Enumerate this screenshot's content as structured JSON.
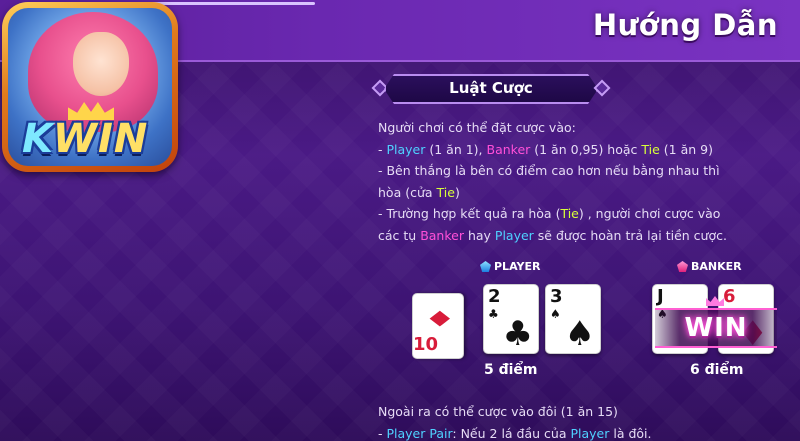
{
  "header": {
    "title": "Hướng Dẫn"
  },
  "logo": {
    "text_k": "K",
    "text_rest": "WIN"
  },
  "section": {
    "title": "Luật Cược"
  },
  "rules": {
    "intro": "Người chơi có thể đặt cược vào:",
    "line1": {
      "prefix": "- ",
      "player": "Player",
      "player_odds": " (1 ăn 1), ",
      "banker": "Banker",
      "banker_odds": " (1 ăn 0,95) hoặc ",
      "tie": "Tie",
      "tie_odds": " (1 ăn 9)"
    },
    "line2": "- Bên thắng là bên có điểm cao hơn nếu bằng nhau thì",
    "line3": {
      "text": "hòa (cửa ",
      "tie": "Tie",
      "end": ")"
    },
    "line4": {
      "text": "- Trường hợp kết quả ra hòa (",
      "tie": "Tie",
      "end": ") , người chơi cược vào"
    },
    "line5": {
      "text": "các tụ ",
      "banker": "Banker",
      "mid": " hay ",
      "player": "Player",
      "end": " sẽ được hoàn trả lại tiền cược."
    }
  },
  "player_side": {
    "label": "PLAYER",
    "cards": [
      {
        "rank": "10",
        "suit": "♦",
        "color": "red",
        "rotated": true
      },
      {
        "rank": "2",
        "suit": "♣",
        "color": "black",
        "rotated": false
      },
      {
        "rank": "3",
        "suit": "♠",
        "color": "black",
        "rotated": false
      }
    ],
    "points": "5 điểm"
  },
  "banker_side": {
    "label": "BANKER",
    "cards": [
      {
        "rank": "J",
        "suit": "♠",
        "color": "black"
      },
      {
        "rank": "6",
        "suit": "♦",
        "color": "red"
      }
    ],
    "points": "6 điểm",
    "badge": "WIN"
  },
  "extra": {
    "line1": "Ngoài ra có thể cược vào đôi (1 ăn 15)",
    "line2": {
      "prefix": "- ",
      "player_pair": "Player Pair",
      "text": ": Nếu 2 lá đầu của ",
      "player": "Player",
      "end": " là đôi."
    }
  },
  "colors": {
    "player": "#4fd1ff",
    "banker": "#ff4fd8",
    "tie": "#d8ff3a",
    "background": "#4a1a85"
  }
}
